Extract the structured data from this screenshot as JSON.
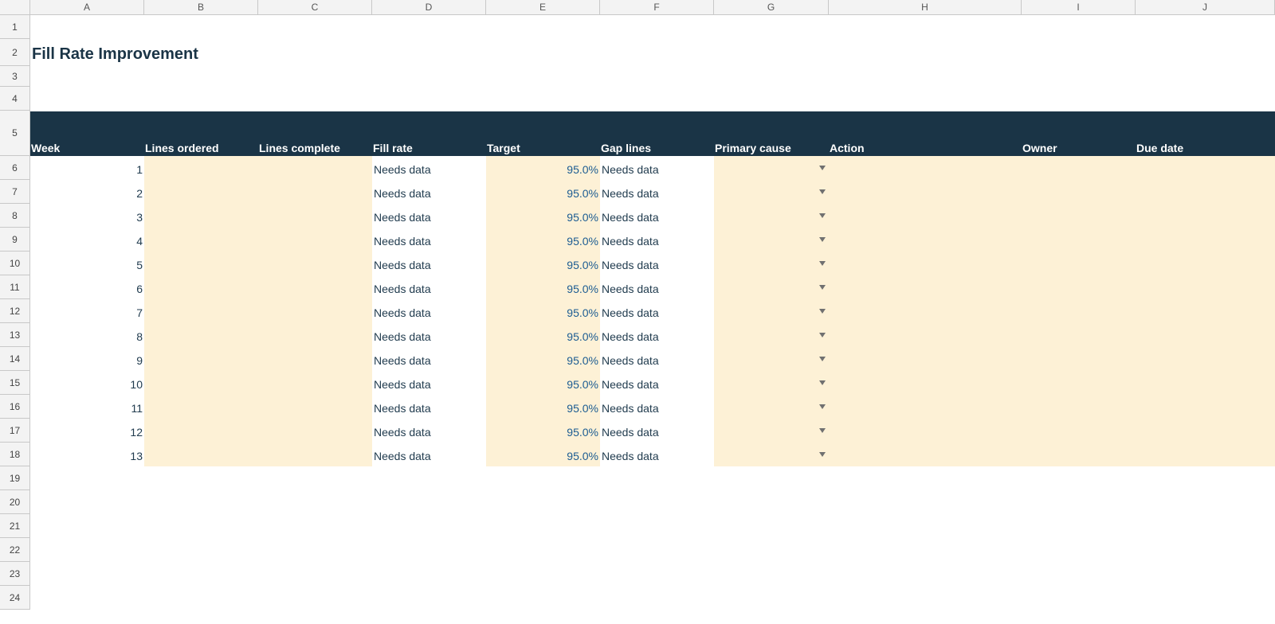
{
  "sheet": {
    "title": "Fill Rate Improvement",
    "column_letters": [
      "A",
      "B",
      "C",
      "D",
      "E",
      "F",
      "G",
      "H",
      "I",
      "J"
    ],
    "row_numbers": [
      "1",
      "2",
      "3",
      "4",
      "5",
      "6",
      "7",
      "8",
      "9",
      "10",
      "11",
      "12",
      "13",
      "14",
      "15",
      "16",
      "17",
      "18",
      "19",
      "20",
      "21",
      "22",
      "23",
      "24"
    ],
    "headers": [
      "Week",
      "Lines ordered",
      "Lines complete",
      "Fill rate",
      "Target",
      "Gap lines",
      "Primary cause",
      "Action",
      "Owner",
      "Due date"
    ],
    "rows": [
      {
        "week": "1",
        "fill_rate": "Needs data",
        "target": "95.0%",
        "gap_lines": "Needs data"
      },
      {
        "week": "2",
        "fill_rate": "Needs data",
        "target": "95.0%",
        "gap_lines": "Needs data"
      },
      {
        "week": "3",
        "fill_rate": "Needs data",
        "target": "95.0%",
        "gap_lines": "Needs data"
      },
      {
        "week": "4",
        "fill_rate": "Needs data",
        "target": "95.0%",
        "gap_lines": "Needs data"
      },
      {
        "week": "5",
        "fill_rate": "Needs data",
        "target": "95.0%",
        "gap_lines": "Needs data"
      },
      {
        "week": "6",
        "fill_rate": "Needs data",
        "target": "95.0%",
        "gap_lines": "Needs data"
      },
      {
        "week": "7",
        "fill_rate": "Needs data",
        "target": "95.0%",
        "gap_lines": "Needs data"
      },
      {
        "week": "8",
        "fill_rate": "Needs data",
        "target": "95.0%",
        "gap_lines": "Needs data"
      },
      {
        "week": "9",
        "fill_rate": "Needs data",
        "target": "95.0%",
        "gap_lines": "Needs data"
      },
      {
        "week": "10",
        "fill_rate": "Needs data",
        "target": "95.0%",
        "gap_lines": "Needs data"
      },
      {
        "week": "11",
        "fill_rate": "Needs data",
        "target": "95.0%",
        "gap_lines": "Needs data"
      },
      {
        "week": "12",
        "fill_rate": "Needs data",
        "target": "95.0%",
        "gap_lines": "Needs data"
      },
      {
        "week": "13",
        "fill_rate": "Needs data",
        "target": "95.0%",
        "gap_lines": "Needs data"
      }
    ]
  },
  "colors": {
    "header_band": "#1a3446",
    "input_fill": "#fdf1d6",
    "title_text": "#1a3446",
    "body_text": "#1f3a4d",
    "percent_text": "#1c5c92",
    "gridline_header_bg": "#f3f3f3"
  },
  "icons": {
    "dropdown": "chevron-down-icon"
  }
}
